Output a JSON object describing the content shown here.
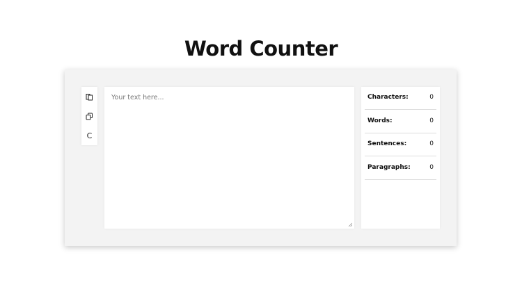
{
  "title": "Word Counter",
  "toolbar": {
    "buttons": [
      {
        "icon": "paste-icon"
      },
      {
        "icon": "copy-icon"
      },
      {
        "label": "C",
        "icon": "clear-icon"
      }
    ]
  },
  "editor": {
    "placeholder": "Your text here...",
    "value": ""
  },
  "stats": [
    {
      "label": "Characters:",
      "value": "0"
    },
    {
      "label": "Words:",
      "value": "0"
    },
    {
      "label": "Sentences:",
      "value": "0"
    },
    {
      "label": "Paragraphs:",
      "value": "0"
    }
  ],
  "colors": {
    "background": "#ffffff",
    "card": "#f3f3f3",
    "panel": "#ffffff",
    "text": "#111111"
  }
}
